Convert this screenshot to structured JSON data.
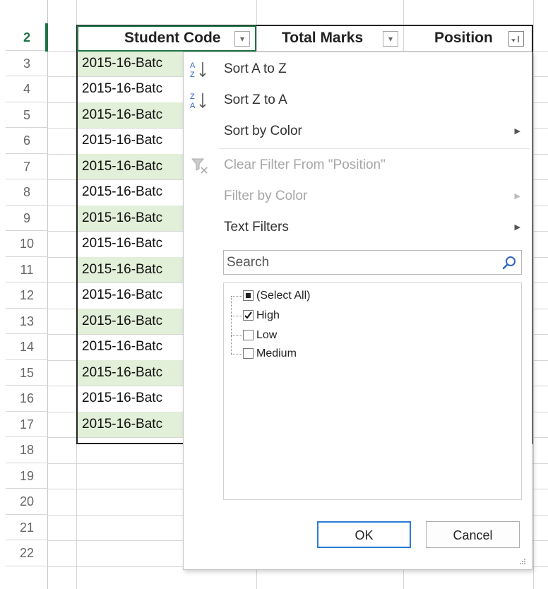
{
  "sheet": {
    "rows": [
      {
        "num": "2",
        "active": true
      },
      {
        "num": "3"
      },
      {
        "num": "4"
      },
      {
        "num": "5"
      },
      {
        "num": "6"
      },
      {
        "num": "7"
      },
      {
        "num": "8"
      },
      {
        "num": "9"
      },
      {
        "num": "10"
      },
      {
        "num": "11"
      },
      {
        "num": "12"
      },
      {
        "num": "13"
      },
      {
        "num": "14"
      },
      {
        "num": "15"
      },
      {
        "num": "16"
      },
      {
        "num": "17"
      },
      {
        "num": "18"
      },
      {
        "num": "19"
      },
      {
        "num": "20"
      },
      {
        "num": "21"
      },
      {
        "num": "22"
      }
    ],
    "headers": {
      "student_code": "Student Code",
      "total_marks": "Total Marks",
      "position": "Position"
    },
    "student_codes": [
      "2015-16-Batc",
      "2015-16-Batc",
      "2015-16-Batc",
      "2015-16-Batc",
      "2015-16-Batc",
      "2015-16-Batc",
      "2015-16-Batc",
      "2015-16-Batc",
      "2015-16-Batc",
      "2015-16-Batc",
      "2015-16-Batc",
      "2015-16-Batc",
      "2015-16-Batc",
      "2015-16-Batc",
      "2015-16-Batc"
    ],
    "banded_color": "#e2efd9",
    "selection_color": "#217346"
  },
  "filter_menu": {
    "sort_asc": "Sort A to Z",
    "sort_desc": "Sort Z to A",
    "sort_by_color": "Sort by Color",
    "clear_filter": "Clear Filter From \"Position\"",
    "filter_by_color": "Filter by Color",
    "text_filters": "Text Filters",
    "search_placeholder": "Search",
    "values": [
      {
        "label": "(Select All)",
        "state": "partial"
      },
      {
        "label": "High",
        "state": "checked"
      },
      {
        "label": "Low",
        "state": "unchecked"
      },
      {
        "label": "Medium",
        "state": "unchecked"
      }
    ],
    "ok_label": "OK",
    "cancel_label": "Cancel",
    "ok_border_color": "#2b7cd3"
  }
}
